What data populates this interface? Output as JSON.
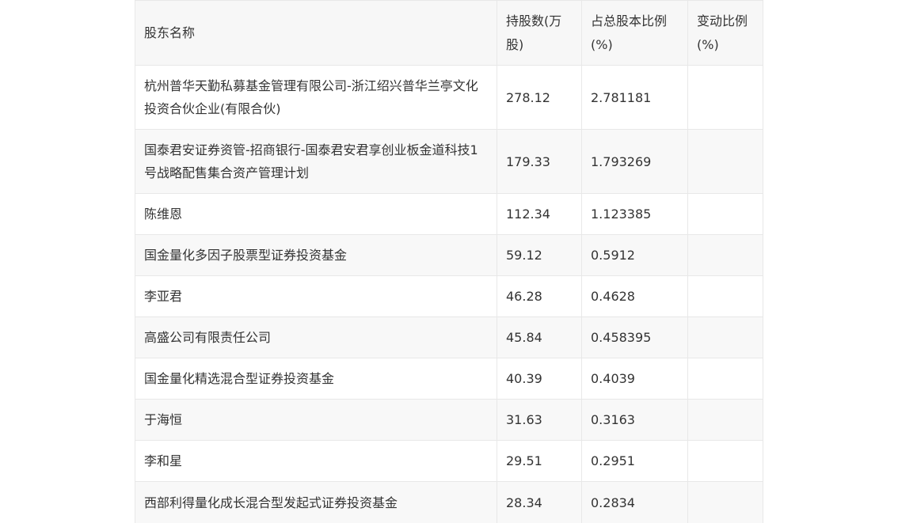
{
  "table": {
    "headers": {
      "name": "股东名称",
      "shares": "持股数(万股)",
      "ratio": "占总股本比例(%)",
      "change": "变动比例(%)"
    },
    "rows": [
      {
        "name": "杭州普华天勤私募基金管理有限公司-浙江绍兴普华兰亭文化投资合伙企业(有限合伙)",
        "shares": "278.12",
        "ratio": "2.781181",
        "change": ""
      },
      {
        "name": "国泰君安证券资管-招商银行-国泰君安君享创业板金道科技1号战略配售集合资产管理计划",
        "shares": "179.33",
        "ratio": "1.793269",
        "change": ""
      },
      {
        "name": "陈维恩",
        "shares": "112.34",
        "ratio": "1.123385",
        "change": ""
      },
      {
        "name": "国金量化多因子股票型证券投资基金",
        "shares": "59.12",
        "ratio": "0.5912",
        "change": ""
      },
      {
        "name": "李亚君",
        "shares": "46.28",
        "ratio": "0.4628",
        "change": ""
      },
      {
        "name": "高盛公司有限责任公司",
        "shares": "45.84",
        "ratio": "0.458395",
        "change": ""
      },
      {
        "name": "国金量化精选混合型证券投资基金",
        "shares": "40.39",
        "ratio": "0.4039",
        "change": ""
      },
      {
        "name": "于海恒",
        "shares": "31.63",
        "ratio": "0.3163",
        "change": ""
      },
      {
        "name": "李和星",
        "shares": "29.51",
        "ratio": "0.2951",
        "change": ""
      },
      {
        "name": "西部利得量化成长混合型发起式证券投资基金",
        "shares": "28.34",
        "ratio": "0.2834",
        "change": ""
      }
    ]
  }
}
